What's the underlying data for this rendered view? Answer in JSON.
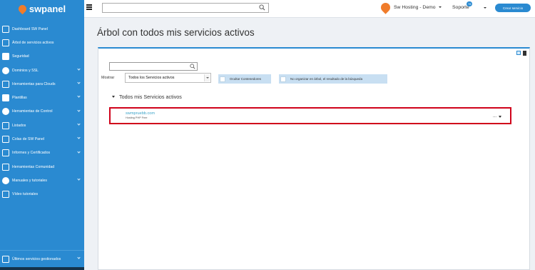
{
  "brand": {
    "name": "swpanel"
  },
  "sidebar": {
    "items": [
      {
        "label": "Dashboard SW Panel",
        "icon": "dashboard-icon",
        "has_children": false
      },
      {
        "label": "Árbol de servicios activos",
        "icon": "tree-icon",
        "has_children": false
      },
      {
        "label": "Seguridad",
        "icon": "shield-icon",
        "has_children": false
      },
      {
        "label": "Dominios y SSL",
        "icon": "globe-icon",
        "has_children": true
      },
      {
        "label": "Herramientas para Clouds",
        "icon": "toolbox-icon",
        "has_children": true
      },
      {
        "label": "Plantillas",
        "icon": "file-icon",
        "has_children": true
      },
      {
        "label": "Herramientas de Control",
        "icon": "check-circle-icon",
        "has_children": true
      },
      {
        "label": "Listados",
        "icon": "list-icon",
        "has_children": true
      },
      {
        "label": "Colas de SW Panel",
        "icon": "stack-icon",
        "has_children": true
      },
      {
        "label": "Informes y Certificados",
        "icon": "report-icon",
        "has_children": true
      },
      {
        "label": "Herramientas Comunidad",
        "icon": "toolbox-icon",
        "has_children": false
      },
      {
        "label": "Manuales y tutoriales",
        "icon": "question-icon",
        "has_children": true
      },
      {
        "label": "Vídeo tutoriales",
        "icon": "video-icon",
        "has_children": false
      }
    ],
    "bottom": {
      "label": "Últimos servicios gestionados",
      "icon": "history-icon"
    }
  },
  "topbar": {
    "search_value": "",
    "user_name": "Sw Hosting - Demo",
    "support_label": "Soporte",
    "support_badge": "78",
    "create_button": "Crear servicio"
  },
  "page": {
    "title": "Árbol con todos mis servicios activos"
  },
  "filters": {
    "search_value": "",
    "show_label": "Mostrar",
    "show_selected": "Todos los Servicios activos",
    "hide_containers_label": "Ocultar Contenedores",
    "no_tree_label": "No organizar en árbol, el resultado de la búsqueda"
  },
  "tree": {
    "root_label": "Todos mis Servicios activos",
    "services": [
      {
        "name": "swmpruebb.com",
        "type": "Hosting PHP Free",
        "actions_label": "..."
      }
    ]
  },
  "colors": {
    "primary": "#2a8ad1",
    "brand_orange": "#f07c2b",
    "highlight": "#d0021b"
  }
}
